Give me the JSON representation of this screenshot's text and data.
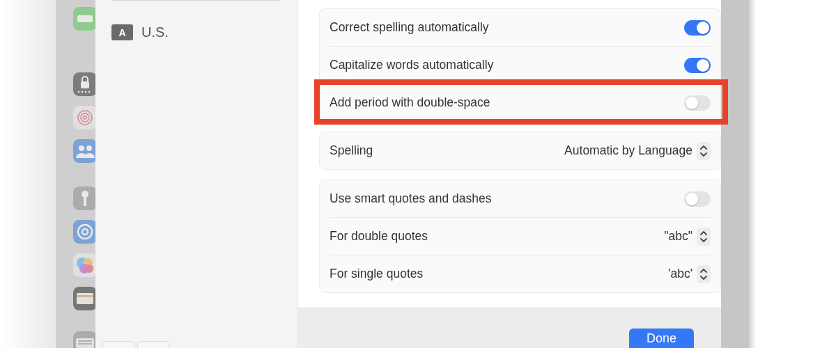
{
  "input_sources": [
    {
      "badge": "A",
      "name": "U.S."
    }
  ],
  "groups": [
    {
      "rows": [
        {
          "kind": "toggle",
          "label": "Correct spelling automatically",
          "on": true,
          "highlighted": false
        },
        {
          "kind": "toggle",
          "label": "Capitalize words automatically",
          "on": true,
          "highlighted": false
        },
        {
          "kind": "toggle",
          "label": "Add period with double-space",
          "on": false,
          "highlighted": true
        }
      ]
    },
    {
      "rows": [
        {
          "kind": "popup",
          "label": "Spelling",
          "value": "Automatic by Language"
        }
      ]
    },
    {
      "rows": [
        {
          "kind": "toggle",
          "label": "Use smart quotes and dashes",
          "on": false,
          "highlighted": false
        },
        {
          "kind": "popup",
          "label": "For double quotes",
          "value": "\"abc\""
        },
        {
          "kind": "popup",
          "label": "For single quotes",
          "value": "'abc'"
        }
      ]
    }
  ],
  "done_button": "Done"
}
